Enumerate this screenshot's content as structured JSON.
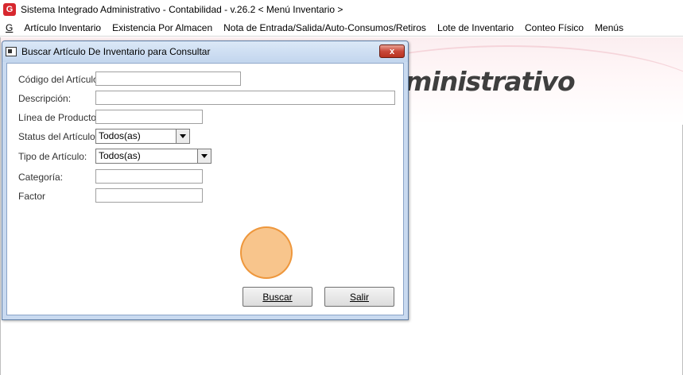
{
  "window": {
    "icon_letter": "G",
    "title": "Sistema Integrado Administrativo - Contabilidad - v.26.2 < Menú Inventario >"
  },
  "menubar": {
    "items": [
      {
        "label": "G"
      },
      {
        "label": "Artículo Inventario"
      },
      {
        "label": "Existencia Por Almacen"
      },
      {
        "label": "Nota de Entrada/Salida/Auto-Consumos/Retiros"
      },
      {
        "label": "Lote de Inventario"
      },
      {
        "label": "Conteo Físico"
      },
      {
        "label": "Menús"
      }
    ]
  },
  "background": {
    "banner_text": "ministrativo"
  },
  "dialog": {
    "title": "Buscar Artículo De Inventario para Consultar",
    "close_label": "x",
    "fields": {
      "codigo_label": "Código del Artículo:",
      "codigo_value": "",
      "descripcion_label": "Descripción:",
      "descripcion_value": "",
      "linea_label": "Línea de Producto:",
      "linea_value": "",
      "status_label": "Status del Artículo:",
      "status_value": "Todos(as)",
      "tipo_label": "Tipo de Artículo:",
      "tipo_value": "Todos(as)",
      "categoria_label": "Categoría:",
      "categoria_value": "",
      "factor_label": "Factor",
      "factor_value": ""
    },
    "buttons": {
      "buscar_label": "Buscar",
      "salir_label": "Salir"
    }
  },
  "colors": {
    "close_button": "#c9493a",
    "highlight": "#f5a64e",
    "dialog_frame": "#c9daf0"
  }
}
